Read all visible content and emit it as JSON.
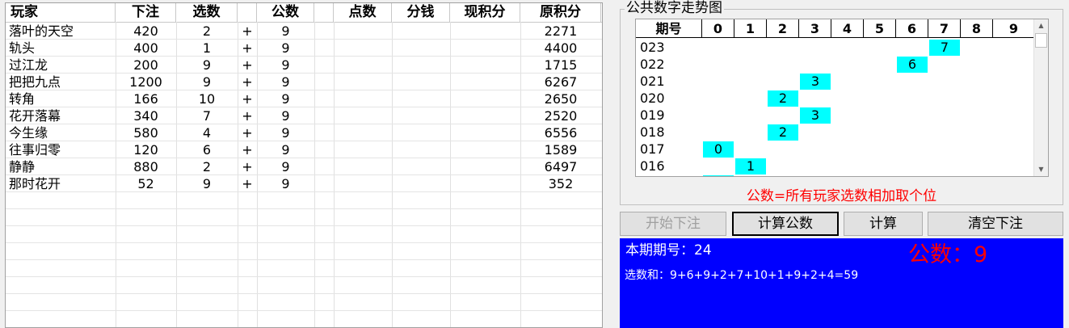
{
  "players_table": {
    "columns": [
      "玩家",
      "下注",
      "选数",
      "",
      "公数",
      "",
      "点数",
      "分钱",
      "现积分",
      "原积分"
    ],
    "rows": [
      [
        "落叶的天空",
        "420",
        "2",
        "+",
        "9",
        "2271"
      ],
      [
        "轨头",
        "400",
        "1",
        "+",
        "9",
        "4400"
      ],
      [
        "过江龙",
        "200",
        "9",
        "+",
        "9",
        "1715"
      ],
      [
        "把把九点",
        "1200",
        "9",
        "+",
        "9",
        "6267"
      ],
      [
        "转角",
        "166",
        "10",
        "+",
        "9",
        "2650"
      ],
      [
        "花开落幕",
        "340",
        "7",
        "+",
        "9",
        "2520"
      ],
      [
        "今生缘",
        "580",
        "4",
        "+",
        "9",
        "6556"
      ],
      [
        "往事归零",
        "120",
        "6",
        "+",
        "9",
        "1589"
      ],
      [
        "静静",
        "880",
        "2",
        "+",
        "9",
        "6497"
      ],
      [
        "那时花开",
        "52",
        "9",
        "+",
        "9",
        "352"
      ]
    ]
  },
  "trend": {
    "title": "公共数字走势图",
    "header": [
      "期号",
      "0",
      "1",
      "2",
      "3",
      "4",
      "5",
      "6",
      "7",
      "8",
      "9"
    ],
    "rows": [
      {
        "period": "023",
        "value": "7",
        "col": 7
      },
      {
        "period": "022",
        "value": "6",
        "col": 6
      },
      {
        "period": "021",
        "value": "3",
        "col": 3
      },
      {
        "period": "020",
        "value": "2",
        "col": 2
      },
      {
        "period": "019",
        "value": "3",
        "col": 3
      },
      {
        "period": "018",
        "value": "2",
        "col": 2
      },
      {
        "period": "017",
        "value": "0",
        "col": 0
      },
      {
        "period": "016",
        "value": "1",
        "col": 1
      }
    ],
    "note": "公数=所有玩家选数相加取个位"
  },
  "buttons": {
    "start_bet": "开始下注",
    "calc_public": "计算公数",
    "calc": "计算",
    "clear_bet": "清空下注"
  },
  "panel": {
    "period_label": "本期期号：24",
    "public_number": "公数：9",
    "sum_text": "选数和：9+6+9+2+7+10+1+9+2+4=59"
  },
  "colors": {
    "highlight": "#00ffff",
    "panel_bg": "#0000ff",
    "note_red": "#ff0000"
  }
}
